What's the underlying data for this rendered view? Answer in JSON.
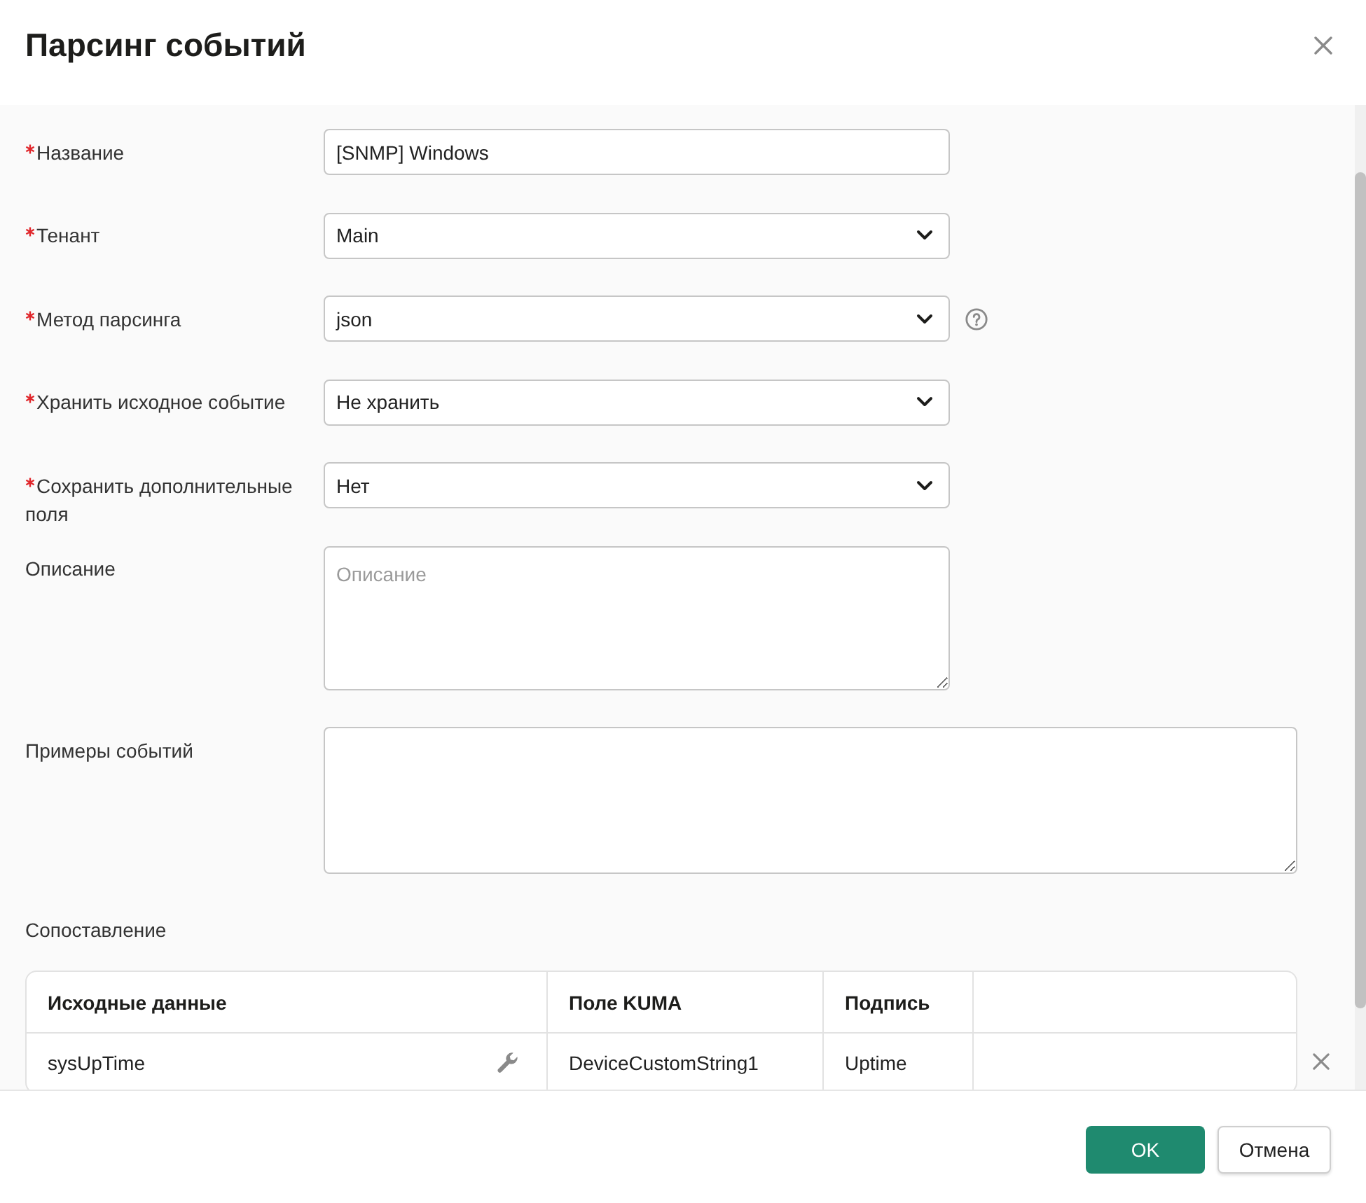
{
  "dialog": {
    "title": "Парсинг событий"
  },
  "fields": [
    {
      "kind": "text",
      "label": "Название",
      "required": true,
      "help": false,
      "value": "[SNMP] Windows"
    },
    {
      "kind": "select",
      "label": "Тенант",
      "required": true,
      "help": false,
      "value": "Main"
    },
    {
      "kind": "select",
      "label": "Метод парсинга",
      "required": true,
      "help": true,
      "value": "json"
    },
    {
      "kind": "select",
      "label": "Хранить исходное событие",
      "required": true,
      "help": false,
      "value": "Не хранить"
    },
    {
      "kind": "select",
      "label": "Сохранить дополнительные поля",
      "required": true,
      "help": false,
      "value": "Нет"
    },
    {
      "kind": "textarea",
      "label": "Описание",
      "required": false,
      "help": false,
      "placeholder": "Описание"
    },
    {
      "kind": "samples",
      "label": "Примеры событий",
      "required": false,
      "help": false
    }
  ],
  "mapping": {
    "label": "Сопоставление",
    "columns": [
      "Исходные данные",
      "Поле KUMA",
      "Подпись"
    ],
    "rows": [
      {
        "source": "sysUpTime",
        "kuma_field": "DeviceCustomString1",
        "caption": "Uptime"
      }
    ]
  },
  "buttons": [
    {
      "label": "OK",
      "kind": "primary"
    },
    {
      "label": "Отмена",
      "kind": "secondary"
    }
  ]
}
